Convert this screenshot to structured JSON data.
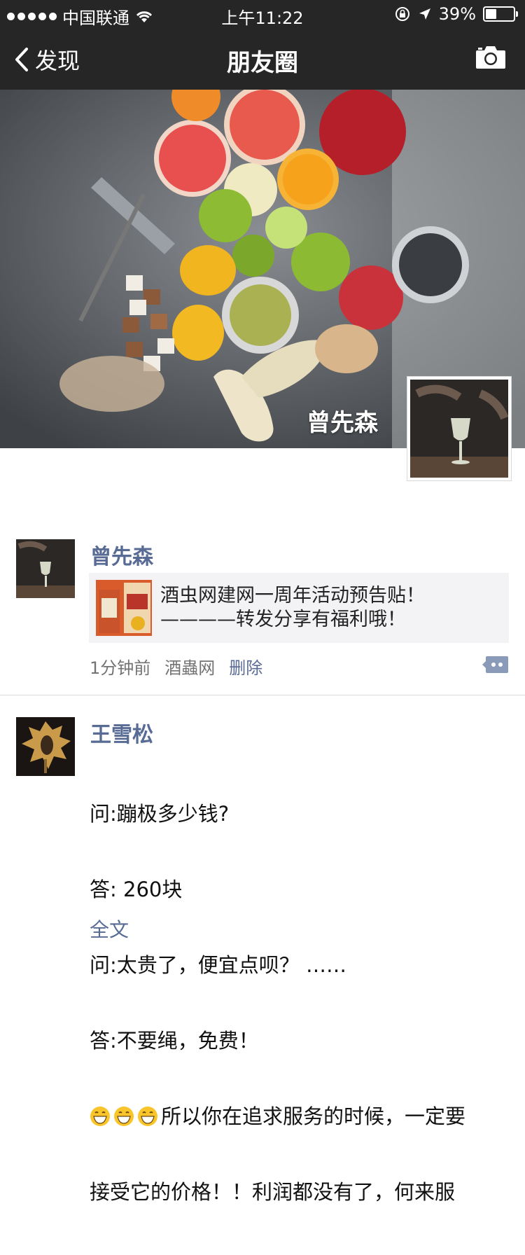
{
  "status_bar": {
    "carrier": "中国联通",
    "time": "上午11:22",
    "battery": "39%",
    "battery_level": 0.39
  },
  "nav": {
    "back_label": "发现",
    "title": "朋友圈",
    "camera_icon": "camera-icon"
  },
  "cover": {
    "owner_name": "曾先森"
  },
  "posts": [
    {
      "name": "曾先森",
      "share": {
        "line1": "酒虫网建网一周年活动预告贴！",
        "line2": "————转发分享有福利哦！"
      },
      "time": "1分钟前",
      "source": "酒蟲网",
      "delete_label": "删除"
    },
    {
      "name": "王雪松",
      "lines": [
        "问:蹦极多少钱?",
        "答: 260块",
        "问:太贵了，便宜点呗？ ……",
        "答:不要绳，免费！"
      ],
      "line5": "所以你在追求服务的时候，一定要",
      "line6": "接受它的价格！！利润都没有了，何来服",
      "fulltext_label": "全文"
    }
  ],
  "colors": {
    "nav_bg": "#262626",
    "link": "#576b95"
  }
}
